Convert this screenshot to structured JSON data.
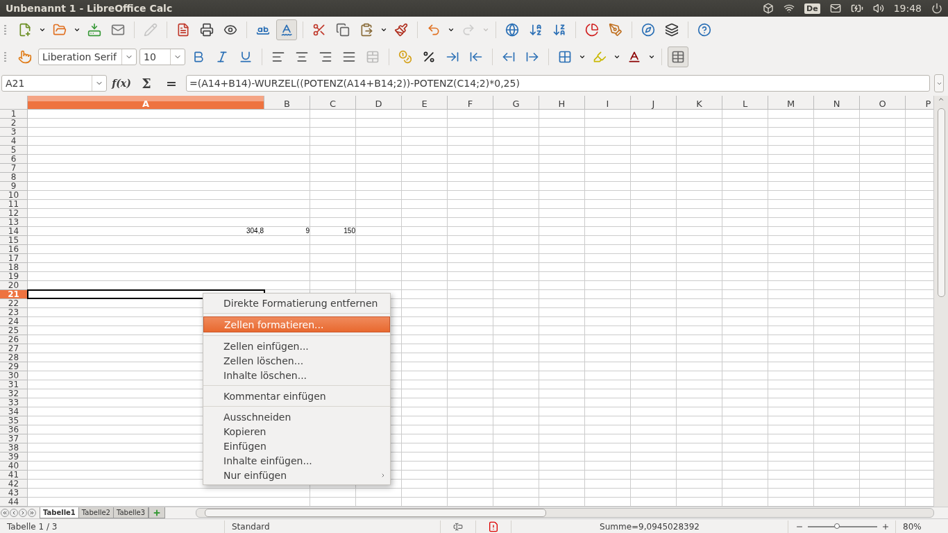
{
  "top_panel": {
    "title": "Unbenannt 1 - LibreOffice Calc",
    "keyboard_layout": "De",
    "clock": "19:48"
  },
  "toolbar_standard": [
    {
      "kind": "new",
      "pressed": false,
      "disabled": false
    },
    {
      "kind": "dropdown",
      "disabled": false
    },
    {
      "kind": "open",
      "pressed": false,
      "disabled": false
    },
    {
      "kind": "dropdown",
      "disabled": false
    },
    {
      "kind": "save",
      "pressed": false,
      "disabled": false
    },
    {
      "kind": "email",
      "pressed": false,
      "disabled": false
    },
    {
      "kind": "separator"
    },
    {
      "kind": "edit",
      "pressed": false,
      "disabled": true
    },
    {
      "kind": "separator"
    },
    {
      "kind": "pdf",
      "pressed": false,
      "disabled": false
    },
    {
      "kind": "print",
      "pressed": false,
      "disabled": false
    },
    {
      "kind": "preview",
      "pressed": false,
      "disabled": false
    },
    {
      "kind": "separator"
    },
    {
      "kind": "spelling",
      "pressed": false,
      "disabled": false
    },
    {
      "kind": "autospell",
      "pressed": true,
      "disabled": false
    },
    {
      "kind": "separator"
    },
    {
      "kind": "cut",
      "pressed": false,
      "disabled": false
    },
    {
      "kind": "copy",
      "pressed": false,
      "disabled": false
    },
    {
      "kind": "paste",
      "pressed": false,
      "disabled": false
    },
    {
      "kind": "dropdown",
      "disabled": false
    },
    {
      "kind": "clone",
      "pressed": false,
      "disabled": false
    },
    {
      "kind": "separator"
    },
    {
      "kind": "undo",
      "pressed": false,
      "disabled": false
    },
    {
      "kind": "dropdown",
      "disabled": false
    },
    {
      "kind": "redo",
      "pressed": false,
      "disabled": true
    },
    {
      "kind": "dropdown",
      "disabled": true
    },
    {
      "kind": "separator"
    },
    {
      "kind": "hyperlink",
      "pressed": false,
      "disabled": false
    },
    {
      "kind": "sortasc",
      "pressed": false,
      "disabled": false
    },
    {
      "kind": "sortdesc",
      "pressed": false,
      "disabled": false
    },
    {
      "kind": "separator"
    },
    {
      "kind": "chart",
      "pressed": false,
      "disabled": false
    },
    {
      "kind": "draw",
      "pressed": false,
      "disabled": false
    },
    {
      "kind": "separator"
    },
    {
      "kind": "navigator",
      "pressed": false,
      "disabled": false
    },
    {
      "kind": "gallery",
      "pressed": false,
      "disabled": false
    },
    {
      "kind": "separator"
    },
    {
      "kind": "help",
      "pressed": false,
      "disabled": false
    }
  ],
  "toolbar_formatting": [
    {
      "kind": "styles",
      "pressed": false,
      "disabled": false
    },
    {
      "kind": "fontname",
      "value": "Liberation Serif"
    },
    {
      "kind": "fontsize",
      "value": "10"
    },
    {
      "kind": "bold",
      "pressed": false,
      "disabled": false
    },
    {
      "kind": "italic",
      "pressed": false,
      "disabled": false
    },
    {
      "kind": "underline",
      "pressed": false,
      "disabled": false
    },
    {
      "kind": "separator"
    },
    {
      "kind": "alignleft",
      "pressed": false,
      "disabled": false
    },
    {
      "kind": "aligncenter",
      "pressed": false,
      "disabled": false
    },
    {
      "kind": "alignright",
      "pressed": false,
      "disabled": false
    },
    {
      "kind": "justify",
      "pressed": false,
      "disabled": false
    },
    {
      "kind": "merge",
      "pressed": false,
      "disabled": true
    },
    {
      "kind": "separator"
    },
    {
      "kind": "currency",
      "pressed": false,
      "disabled": false
    },
    {
      "kind": "percent",
      "pressed": false,
      "disabled": false
    },
    {
      "kind": "adddecimal",
      "pressed": false,
      "disabled": false
    },
    {
      "kind": "deldecimal",
      "pressed": false,
      "disabled": false
    },
    {
      "kind": "separator"
    },
    {
      "kind": "outdent",
      "pressed": false,
      "disabled": false
    },
    {
      "kind": "indent",
      "pressed": false,
      "disabled": false
    },
    {
      "kind": "separator"
    },
    {
      "kind": "borders",
      "pressed": false,
      "disabled": false
    },
    {
      "kind": "dropdown",
      "disabled": false
    },
    {
      "kind": "background",
      "pressed": false,
      "disabled": false
    },
    {
      "kind": "dropdown",
      "disabled": false
    },
    {
      "kind": "fontcolor",
      "pressed": false,
      "disabled": false
    },
    {
      "kind": "dropdown",
      "disabled": false
    },
    {
      "kind": "separator"
    },
    {
      "kind": "gridlines",
      "pressed": true,
      "disabled": false
    }
  ],
  "formula_bar": {
    "name_box": "A21",
    "function_wizard": "f(x)",
    "sum": "Σ",
    "equals": "=",
    "formula": "=(A14+B14)-WURZEL((POTENZ(A14+B14;2))-POTENZ(C14;2)*0,25)"
  },
  "columns": [
    {
      "label": "A",
      "selected": true
    },
    {
      "label": "B",
      "selected": false
    },
    {
      "label": "C",
      "selected": false
    },
    {
      "label": "D",
      "selected": false
    },
    {
      "label": "E",
      "selected": false
    },
    {
      "label": "F",
      "selected": false
    },
    {
      "label": "G",
      "selected": false
    },
    {
      "label": "H",
      "selected": false
    },
    {
      "label": "I",
      "selected": false
    },
    {
      "label": "J",
      "selected": false
    },
    {
      "label": "K",
      "selected": false
    },
    {
      "label": "L",
      "selected": false
    },
    {
      "label": "M",
      "selected": false
    },
    {
      "label": "N",
      "selected": false
    },
    {
      "label": "O",
      "selected": false
    },
    {
      "label": "P",
      "selected": false
    }
  ],
  "rows": [
    {
      "label": "1",
      "selected": false
    },
    {
      "label": "2",
      "selected": false
    },
    {
      "label": "3",
      "selected": false
    },
    {
      "label": "4",
      "selected": false
    },
    {
      "label": "5",
      "selected": false
    },
    {
      "label": "6",
      "selected": false
    },
    {
      "label": "7",
      "selected": false
    },
    {
      "label": "8",
      "selected": false
    },
    {
      "label": "9",
      "selected": false
    },
    {
      "label": "10",
      "selected": false
    },
    {
      "label": "11",
      "selected": false
    },
    {
      "label": "12",
      "selected": false
    },
    {
      "label": "13",
      "selected": false
    },
    {
      "label": "14",
      "selected": false,
      "cells": [
        "304,8",
        "9",
        "150"
      ]
    },
    {
      "label": "15",
      "selected": false
    },
    {
      "label": "16",
      "selected": false
    },
    {
      "label": "17",
      "selected": false
    },
    {
      "label": "18",
      "selected": false
    },
    {
      "label": "19",
      "selected": false
    },
    {
      "label": "20",
      "selected": false
    },
    {
      "label": "21",
      "selected": true
    },
    {
      "label": "22",
      "selected": false
    },
    {
      "label": "23",
      "selected": false
    },
    {
      "label": "24",
      "selected": false
    },
    {
      "label": "25",
      "selected": false
    },
    {
      "label": "26",
      "selected": false
    },
    {
      "label": "27",
      "selected": false
    },
    {
      "label": "28",
      "selected": false
    },
    {
      "label": "29",
      "selected": false
    },
    {
      "label": "30",
      "selected": false
    },
    {
      "label": "31",
      "selected": false
    },
    {
      "label": "32",
      "selected": false
    },
    {
      "label": "33",
      "selected": false
    },
    {
      "label": "34",
      "selected": false
    },
    {
      "label": "35",
      "selected": false
    },
    {
      "label": "36",
      "selected": false
    },
    {
      "label": "37",
      "selected": false
    },
    {
      "label": "38",
      "selected": false
    },
    {
      "label": "39",
      "selected": false
    },
    {
      "label": "40",
      "selected": false
    },
    {
      "label": "41",
      "selected": false
    },
    {
      "label": "42",
      "selected": false
    },
    {
      "label": "43",
      "selected": false
    },
    {
      "label": "44",
      "selected": false
    }
  ],
  "context_menu": [
    {
      "kind": "item",
      "label": "Direkte Formatierung entfernen",
      "selected": false,
      "submenu": false
    },
    {
      "kind": "separator"
    },
    {
      "kind": "item",
      "label": "Zellen formatieren...",
      "selected": true,
      "submenu": false
    },
    {
      "kind": "separator"
    },
    {
      "kind": "item",
      "label": "Zellen einfügen...",
      "selected": false,
      "submenu": false
    },
    {
      "kind": "item",
      "label": "Zellen löschen...",
      "selected": false,
      "submenu": false
    },
    {
      "kind": "item",
      "label": "Inhalte löschen...",
      "selected": false,
      "submenu": false
    },
    {
      "kind": "separator"
    },
    {
      "kind": "item",
      "label": "Kommentar einfügen",
      "selected": false,
      "submenu": false
    },
    {
      "kind": "separator"
    },
    {
      "kind": "item",
      "label": "Ausschneiden",
      "selected": false,
      "submenu": false
    },
    {
      "kind": "item",
      "label": "Kopieren",
      "selected": false,
      "submenu": false
    },
    {
      "kind": "item",
      "label": "Einfügen",
      "selected": false,
      "submenu": false
    },
    {
      "kind": "item",
      "label": "Inhalte einfügen...",
      "selected": false,
      "submenu": false
    },
    {
      "kind": "item",
      "label": "Nur einfügen",
      "selected": false,
      "submenu": true
    }
  ],
  "sheet_tabs": [
    {
      "label": "Tabelle1",
      "selected": true
    },
    {
      "label": "Tabelle2",
      "selected": false
    },
    {
      "label": "Tabelle3",
      "selected": false
    }
  ],
  "status_bar": {
    "sheet": "Tabelle 1 / 3",
    "page_style": "Standard",
    "sum": "Summe=9,0945028392",
    "zoom_slider": {
      "level": 0.42
    },
    "zoom": "80%"
  }
}
